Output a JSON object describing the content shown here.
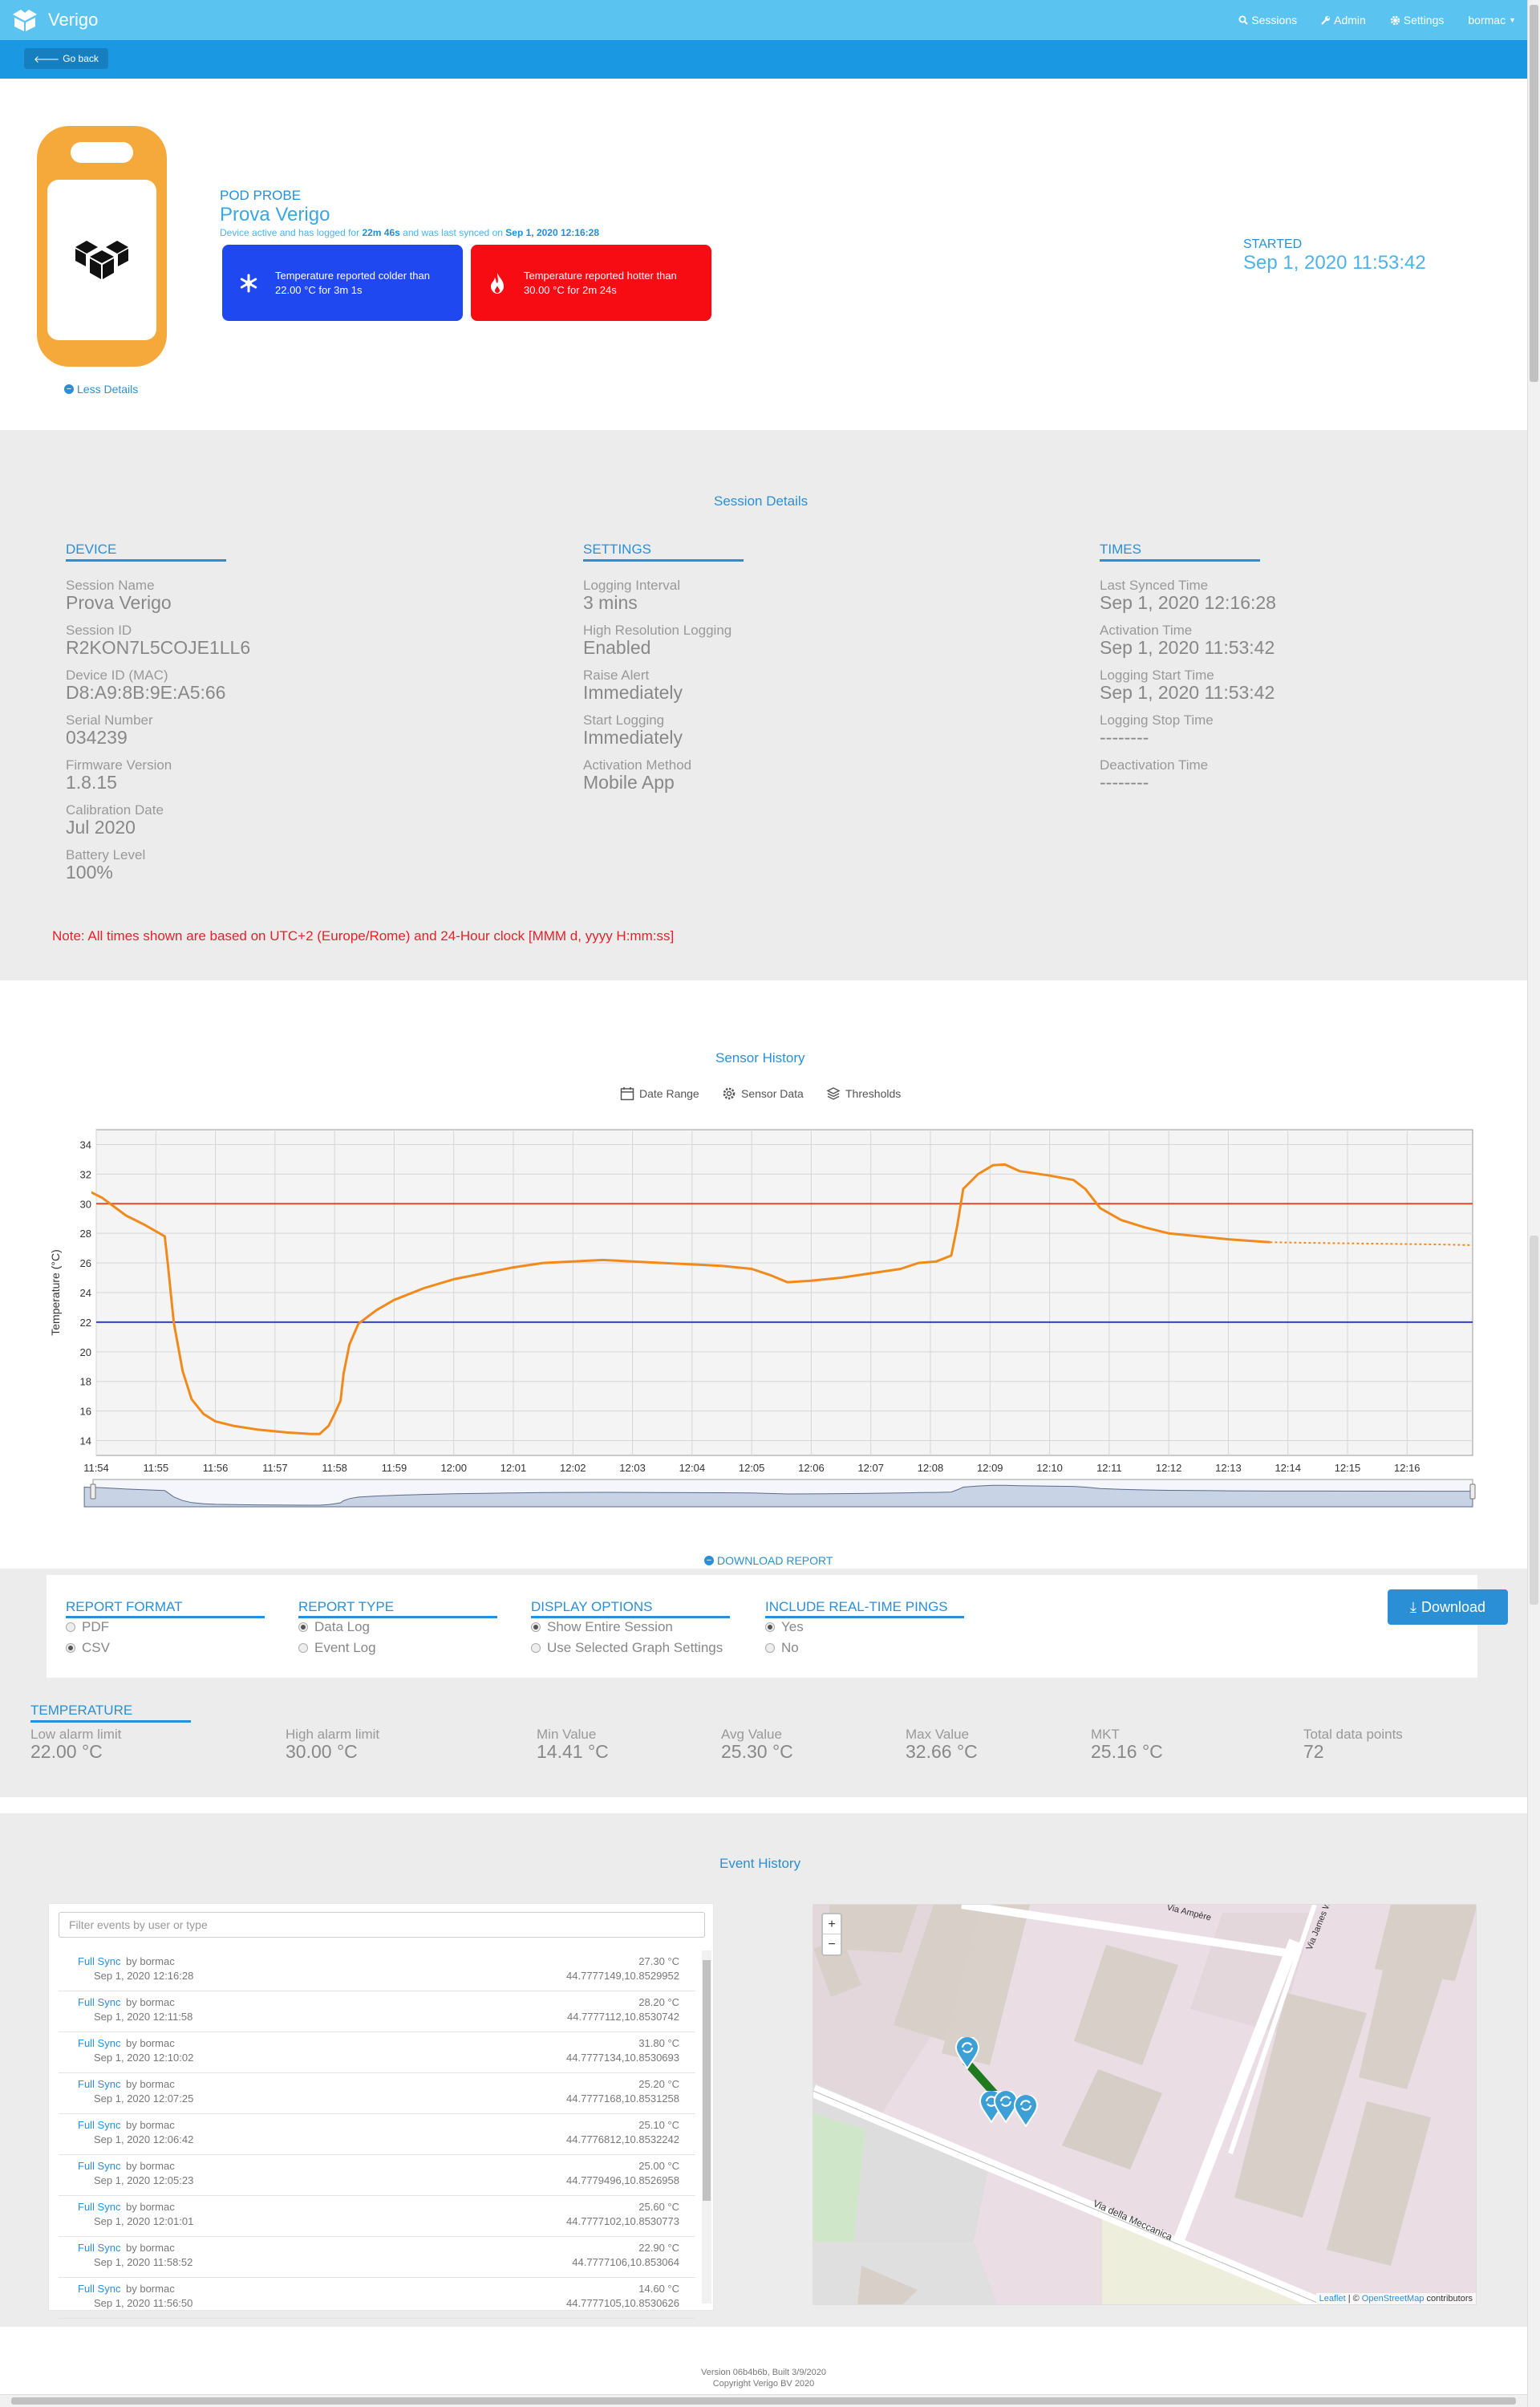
{
  "nav": {
    "brand": "Verigo",
    "sessions": "Sessions",
    "admin": "Admin",
    "settings": "Settings",
    "user": "bormac",
    "go_back": "Go back"
  },
  "header": {
    "less_details": "Less Details",
    "pod_label": "POD PROBE",
    "pod_name": "Prova Verigo",
    "status_prefix": "Device active and has logged for",
    "logged_for": "22m 46s",
    "status_middle": "and was last synced on",
    "last_synced": "Sep 1, 2020 12:16:28",
    "alert_cold": "Temperature reported colder than 22.00 °C for 3m 1s",
    "alert_hot": "Temperature reported hotter than 30.00 °C for 2m 24s",
    "started_label": "STARTED",
    "started_value": "Sep 1, 2020 11:53:42",
    "colors": {
      "cold": "#1f48f0",
      "hot": "#f60c12",
      "device": "#f6a93b"
    }
  },
  "session_details": {
    "title": "Session Details",
    "device": {
      "heading": "DEVICE",
      "fields": [
        {
          "label": "Session Name",
          "value": "Prova Verigo"
        },
        {
          "label": "Session ID",
          "value": "R2KON7L5COJE1LL6"
        },
        {
          "label": "Device ID (MAC)",
          "value": "D8:A9:8B:9E:A5:66"
        },
        {
          "label": "Serial Number",
          "value": "034239"
        },
        {
          "label": "Firmware Version",
          "value": "1.8.15"
        },
        {
          "label": "Calibration Date",
          "value": "Jul 2020"
        },
        {
          "label": "Battery Level",
          "value": "100%"
        }
      ]
    },
    "settings": {
      "heading": "SETTINGS",
      "fields": [
        {
          "label": "Logging Interval",
          "value": "3 mins"
        },
        {
          "label": "High Resolution Logging",
          "value": "Enabled"
        },
        {
          "label": "Raise Alert",
          "value": "Immediately"
        },
        {
          "label": "Start Logging",
          "value": "Immediately"
        },
        {
          "label": "Activation Method",
          "value": "Mobile App"
        }
      ]
    },
    "times": {
      "heading": "TIMES",
      "fields": [
        {
          "label": "Last Synced Time",
          "value": "Sep 1, 2020 12:16:28"
        },
        {
          "label": "Activation Time",
          "value": "Sep 1, 2020 11:53:42"
        },
        {
          "label": "Logging Start Time",
          "value": "Sep 1, 2020 11:53:42"
        },
        {
          "label": "Logging Stop Time",
          "value": "--------"
        },
        {
          "label": "Deactivation Time",
          "value": "--------"
        }
      ]
    },
    "note": "Note: All times shown are based on UTC+2 (Europe/Rome) and 24-Hour clock [MMM d, yyyy H:mm:ss]"
  },
  "sensor_history": {
    "title": "Sensor History",
    "toolbar": {
      "date_range": "Date Range",
      "sensor_data": "Sensor Data",
      "thresholds": "Thresholds"
    },
    "download_link": "DOWNLOAD REPORT"
  },
  "chart_data": {
    "type": "line",
    "ylabel": "Temperature (°C)",
    "ylim": [
      13,
      35
    ],
    "yticks": [
      "14",
      "16",
      "18",
      "20",
      "22",
      "24",
      "26",
      "28",
      "30",
      "32",
      "34"
    ],
    "xlim": [
      0,
      23.1
    ],
    "xticks": [
      {
        "t": 0,
        "label": "11:54"
      },
      {
        "t": 1,
        "label": "11:55"
      },
      {
        "t": 2,
        "label": "11:56"
      },
      {
        "t": 3,
        "label": "11:57"
      },
      {
        "t": 4,
        "label": "11:58"
      },
      {
        "t": 5,
        "label": "11:59"
      },
      {
        "t": 6,
        "label": "12:00"
      },
      {
        "t": 7,
        "label": "12:01"
      },
      {
        "t": 8,
        "label": "12:02"
      },
      {
        "t": 9,
        "label": "12:03"
      },
      {
        "t": 10,
        "label": "12:04"
      },
      {
        "t": 11,
        "label": "12:05"
      },
      {
        "t": 12,
        "label": "12:06"
      },
      {
        "t": 13,
        "label": "12:07"
      },
      {
        "t": 14,
        "label": "12:08"
      },
      {
        "t": 15,
        "label": "12:09"
      },
      {
        "t": 16,
        "label": "12:10"
      },
      {
        "t": 17,
        "label": "12:11"
      },
      {
        "t": 18,
        "label": "12:12"
      },
      {
        "t": 19,
        "label": "12:13"
      },
      {
        "t": 20,
        "label": "12:14"
      },
      {
        "t": 21,
        "label": "12:15"
      },
      {
        "t": 22,
        "label": "12:16"
      }
    ],
    "thresholds": {
      "high": 30,
      "low": 22,
      "high_color": "#e0492b",
      "low_color": "#2f3fd6"
    },
    "series": [
      {
        "color": "#f08a1c",
        "points": [
          [
            -0.2,
            31.0
          ],
          [
            0.1,
            30.4
          ],
          [
            0.5,
            29.2
          ],
          [
            0.8,
            28.6
          ],
          [
            1.15,
            27.8
          ],
          [
            1.2,
            26.0
          ],
          [
            1.3,
            22.0
          ],
          [
            1.45,
            18.7
          ],
          [
            1.6,
            16.8
          ],
          [
            1.8,
            15.8
          ],
          [
            2.0,
            15.3
          ],
          [
            2.3,
            15.0
          ],
          [
            2.7,
            14.75
          ],
          [
            3.2,
            14.55
          ],
          [
            3.6,
            14.45
          ],
          [
            3.75,
            14.45
          ],
          [
            3.9,
            15.0
          ],
          [
            4.0,
            15.8
          ],
          [
            4.1,
            16.7
          ],
          [
            4.15,
            18.5
          ],
          [
            4.25,
            20.5
          ],
          [
            4.4,
            21.9
          ],
          [
            4.7,
            22.8
          ],
          [
            5.0,
            23.5
          ],
          [
            5.5,
            24.3
          ],
          [
            6.0,
            24.9
          ],
          [
            6.5,
            25.3
          ],
          [
            7.0,
            25.7
          ],
          [
            7.5,
            26.0
          ],
          [
            8.0,
            26.1
          ],
          [
            8.5,
            26.2
          ],
          [
            9.0,
            26.1
          ],
          [
            9.5,
            26.0
          ],
          [
            10.0,
            25.9
          ],
          [
            10.5,
            25.8
          ],
          [
            11.0,
            25.6
          ],
          [
            11.3,
            25.2
          ],
          [
            11.6,
            24.7
          ],
          [
            12.0,
            24.8
          ],
          [
            12.5,
            25.0
          ],
          [
            13.0,
            25.3
          ],
          [
            13.5,
            25.6
          ],
          [
            13.8,
            26.0
          ],
          [
            14.1,
            26.1
          ],
          [
            14.35,
            26.5
          ],
          [
            14.45,
            28.5
          ],
          [
            14.55,
            31.0
          ],
          [
            14.8,
            32.0
          ],
          [
            15.05,
            32.6
          ],
          [
            15.25,
            32.65
          ],
          [
            15.5,
            32.2
          ],
          [
            16.0,
            31.9
          ],
          [
            16.4,
            31.6
          ],
          [
            16.6,
            31.0
          ],
          [
            16.85,
            29.7
          ],
          [
            17.2,
            28.9
          ],
          [
            17.6,
            28.4
          ],
          [
            18.0,
            28.0
          ],
          [
            18.5,
            27.8
          ],
          [
            19.0,
            27.6
          ],
          [
            19.5,
            27.45
          ],
          [
            19.7,
            27.4
          ]
        ],
        "projected": [
          [
            19.7,
            27.4
          ],
          [
            20.5,
            27.35
          ],
          [
            21.5,
            27.3
          ],
          [
            22.5,
            27.25
          ],
          [
            23.1,
            27.2
          ]
        ]
      }
    ],
    "grid": true
  },
  "report": {
    "format": {
      "heading": "REPORT FORMAT",
      "options": [
        {
          "label": "PDF",
          "selected": false
        },
        {
          "label": "CSV",
          "selected": true
        }
      ]
    },
    "type": {
      "heading": "REPORT TYPE",
      "options": [
        {
          "label": "Data Log",
          "selected": true
        },
        {
          "label": "Event Log",
          "selected": false
        }
      ]
    },
    "display": {
      "heading": "DISPLAY OPTIONS",
      "options": [
        {
          "label": "Show Entire Session",
          "selected": true
        },
        {
          "label": "Use Selected Graph Settings",
          "selected": false
        }
      ]
    },
    "pings": {
      "heading": "INCLUDE REAL-TIME PINGS",
      "options": [
        {
          "label": "Yes",
          "selected": true
        },
        {
          "label": "No",
          "selected": false
        }
      ]
    },
    "download_button": "Download"
  },
  "temperature": {
    "heading": "TEMPERATURE",
    "stats": [
      {
        "label": "Low alarm limit",
        "value": "22.00 °C"
      },
      {
        "label": "High alarm limit",
        "value": "30.00 °C"
      },
      {
        "label": "Min Value",
        "value": "14.41 °C"
      },
      {
        "label": "Avg Value",
        "value": "25.30 °C"
      },
      {
        "label": "Max Value",
        "value": "32.66 °C"
      },
      {
        "label": "MKT",
        "value": "25.16 °C"
      },
      {
        "label": "Total data points",
        "value": "72"
      }
    ]
  },
  "event_history": {
    "title": "Event History",
    "filter_placeholder": "Filter events by user or type",
    "events": [
      {
        "type": "Full Sync",
        "by": "by bormac",
        "date": "Sep 1, 2020 12:16:28",
        "temp": "27.30 °C",
        "coords": "44.7777149,10.8529952"
      },
      {
        "type": "Full Sync",
        "by": "by bormac",
        "date": "Sep 1, 2020 12:11:58",
        "temp": "28.20 °C",
        "coords": "44.7777112,10.8530742"
      },
      {
        "type": "Full Sync",
        "by": "by bormac",
        "date": "Sep 1, 2020 12:10:02",
        "temp": "31.80 °C",
        "coords": "44.7777134,10.8530693"
      },
      {
        "type": "Full Sync",
        "by": "by bormac",
        "date": "Sep 1, 2020 12:07:25",
        "temp": "25.20 °C",
        "coords": "44.7777168,10.8531258"
      },
      {
        "type": "Full Sync",
        "by": "by bormac",
        "date": "Sep 1, 2020 12:06:42",
        "temp": "25.10 °C",
        "coords": "44.7776812,10.8532242"
      },
      {
        "type": "Full Sync",
        "by": "by bormac",
        "date": "Sep 1, 2020 12:05:23",
        "temp": "25.00 °C",
        "coords": "44.7779496,10.8526958"
      },
      {
        "type": "Full Sync",
        "by": "by bormac",
        "date": "Sep 1, 2020 12:01:01",
        "temp": "25.60 °C",
        "coords": "44.7777102,10.8530773"
      },
      {
        "type": "Full Sync",
        "by": "by bormac",
        "date": "Sep 1, 2020 11:58:52",
        "temp": "22.90 °C",
        "coords": "44.7777106,10.853064"
      },
      {
        "type": "Full Sync",
        "by": "by bormac",
        "date": "Sep 1, 2020 11:56:50",
        "temp": "14.60 °C",
        "coords": "44.7777105,10.8530626"
      }
    ],
    "map": {
      "zoom_in": "+",
      "zoom_out": "−",
      "street_1": "Via della Meccanica",
      "street_2": "Via Ampère",
      "street_3": "Via James W",
      "attribution_leaflet": "Leaflet",
      "attribution_osm": "OpenStreetMap",
      "attribution_suffix": "contributors"
    }
  },
  "footer": {
    "version": "Version 06b4b6b, Built 3/9/2020",
    "copyright": "Copyright Verigo BV 2020"
  }
}
